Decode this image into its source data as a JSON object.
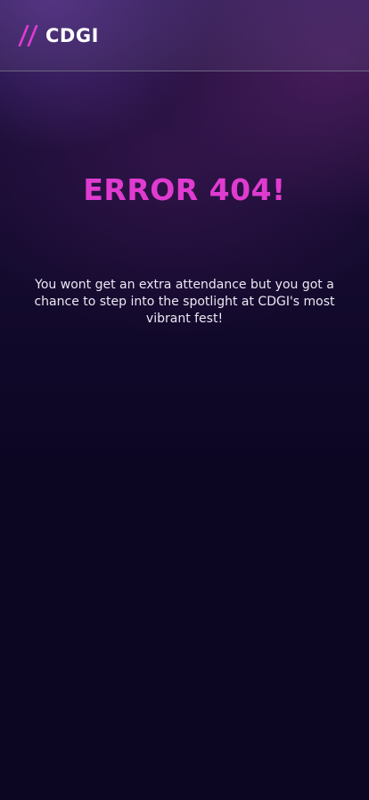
{
  "header": {
    "brand_name": "CDGI",
    "brand_icon": "double-slash-logo-icon",
    "accent_color": "#e03bd0"
  },
  "main": {
    "error_title": "ERROR 404!",
    "error_message": "You wont get an extra attendance but you got a chance to step into the spotlight at CDGI's most vibrant fest!"
  }
}
